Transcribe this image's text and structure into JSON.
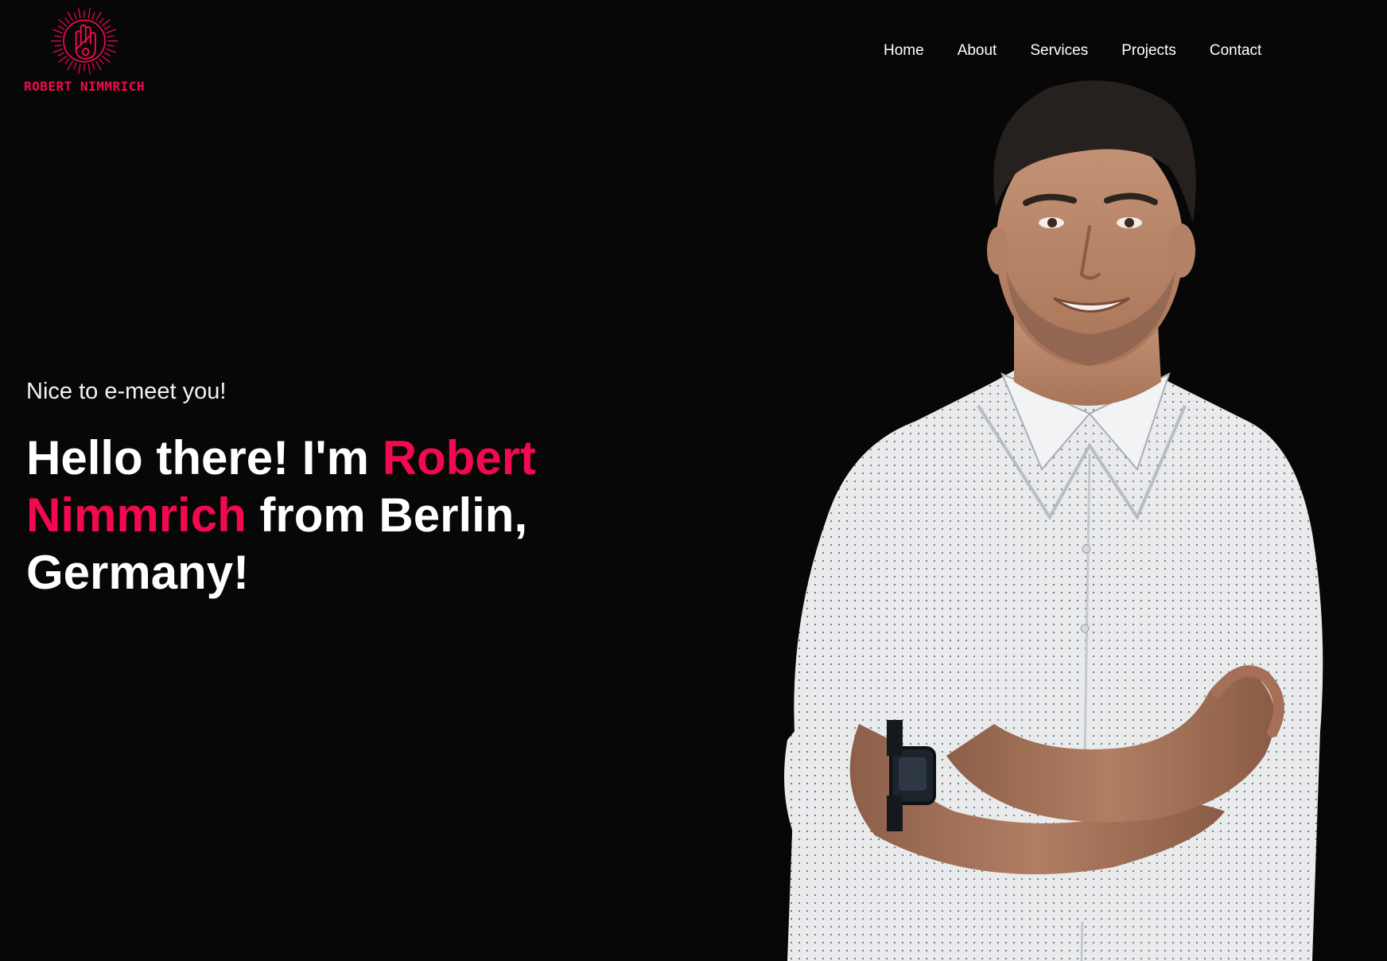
{
  "logo": {
    "text": "ROBERT NIMMRICH",
    "icon": "hand-sunburst-icon",
    "color": "#f2094f"
  },
  "nav": {
    "items": [
      {
        "label": "Home"
      },
      {
        "label": "About"
      },
      {
        "label": "Services"
      },
      {
        "label": "Projects"
      },
      {
        "label": "Contact"
      }
    ]
  },
  "hero": {
    "greeting": "Nice to e-meet you!",
    "headline": {
      "part1": "Hello there! I'm ",
      "name_first": "Robert",
      "name_last": "Nimmrich",
      "part2": " from Berlin, Germany!"
    },
    "accent_color": "#f2094f",
    "background_color": "#070707",
    "portrait": "portrait-photo"
  }
}
